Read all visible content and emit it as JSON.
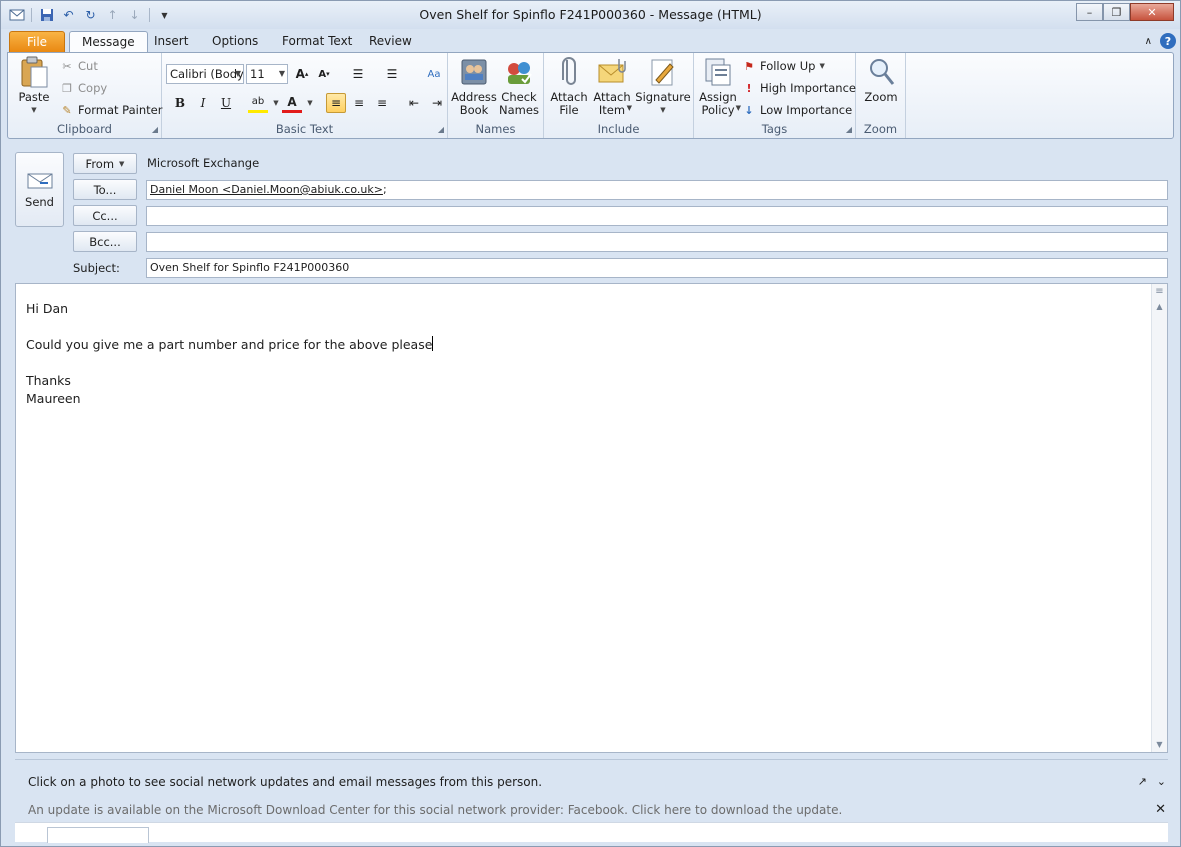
{
  "window": {
    "title": "Oven Shelf for Spinflo F241P000360  -  Message (HTML)",
    "minimize_icon": "minimize-icon",
    "restore_icon": "restore-icon",
    "close_icon": "close-icon"
  },
  "qat": [
    "outlook-icon",
    "save-icon",
    "undo-icon",
    "redo-icon",
    "up-arrow-icon",
    "down-arrow-icon",
    "customize-icon"
  ],
  "tabs": [
    {
      "label": "File"
    },
    {
      "label": "Message"
    },
    {
      "label": "Insert"
    },
    {
      "label": "Options"
    },
    {
      "label": "Format Text"
    },
    {
      "label": "Review"
    }
  ],
  "ribbon": {
    "clipboard": {
      "label": "Clipboard",
      "paste": "Paste",
      "cut": "Cut",
      "copy": "Copy",
      "format_painter": "Format Painter"
    },
    "basic_text": {
      "label": "Basic Text",
      "font": "Calibri (Body)",
      "size": "11"
    },
    "names": {
      "label": "Names",
      "address_book_1": "Address",
      "address_book_2": "Book",
      "check_names_1": "Check",
      "check_names_2": "Names"
    },
    "include": {
      "label": "Include",
      "attach_file_1": "Attach",
      "attach_file_2": "File",
      "attach_item_1": "Attach",
      "attach_item_2": "Item",
      "signature": "Signature"
    },
    "tags": {
      "label": "Tags",
      "assign_policy_1": "Assign",
      "assign_policy_2": "Policy",
      "follow_up": "Follow Up",
      "high_importance": "High Importance",
      "low_importance": "Low Importance"
    },
    "zoom": {
      "label": "Zoom",
      "zoom": "Zoom"
    }
  },
  "header": {
    "send": "Send",
    "from_label": "From",
    "from_value": "Microsoft Exchange",
    "to_label": "To...",
    "to_value": "Daniel Moon <Daniel.Moon@abiuk.co.uk>",
    "to_suffix": ";",
    "cc_label": "Cc...",
    "cc_value": "",
    "bcc_label": "Bcc...",
    "bcc_value": "",
    "subject_label": "Subject:",
    "subject_value": "Oven Shelf for Spinflo F241P000360"
  },
  "body": {
    "lines": [
      "Hi Dan",
      "",
      "Could you give me a part number and price for the above please",
      "",
      "Thanks",
      "Maureen"
    ]
  },
  "people_pane": {
    "social_text": "Click on a photo to see social network updates and email messages from this person.",
    "update_text": "An update is available on the Microsoft Download Center for this social network provider: Facebook. Click here to download the update."
  }
}
